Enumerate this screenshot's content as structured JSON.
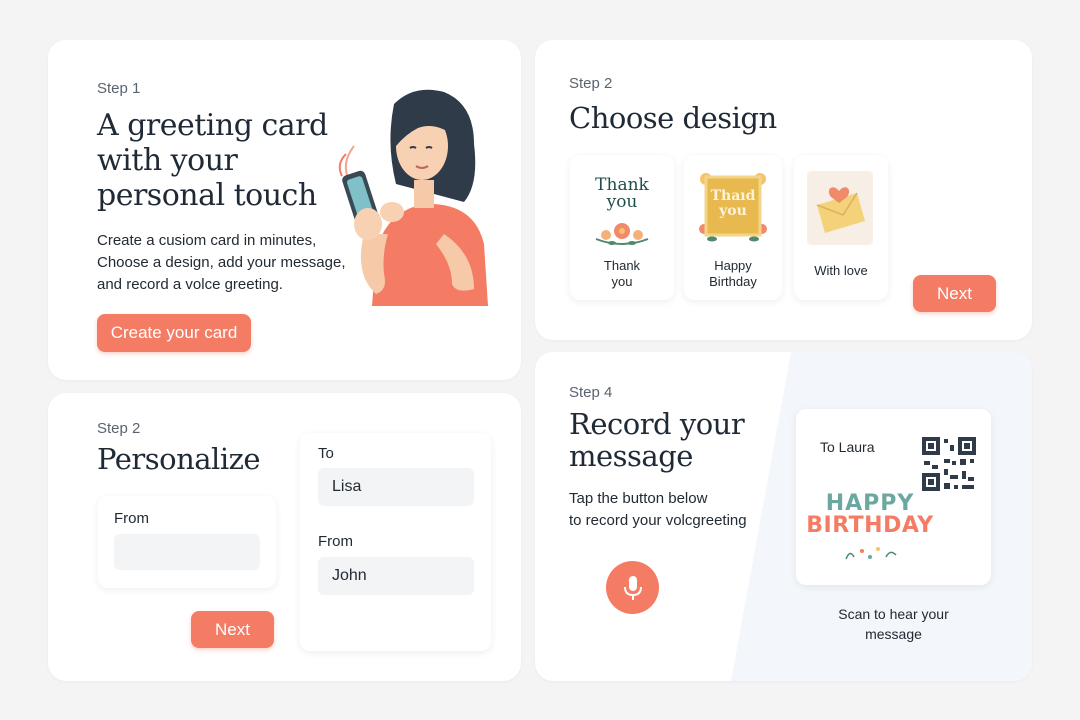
{
  "step1": {
    "step": "Step 1",
    "title_lines": [
      "A greeting card",
      "with your",
      "personal touch"
    ],
    "desc_lines": [
      "Create a cusiom card in minutes,",
      "Choose a design, add your message,",
      "and record a volce greeting."
    ],
    "cta": "Create your card"
  },
  "step2_design": {
    "step": "Step 2",
    "title": "Choose design",
    "designs": [
      {
        "art_text_1": "Thank",
        "art_text_2": "you",
        "label_1": "Thank",
        "label_2": "you"
      },
      {
        "art_text_1": "Thaıd",
        "art_text_2": "you",
        "label_1": "Happy",
        "label_2": "Birthday"
      },
      {
        "label_1": "With love"
      }
    ],
    "next": "Next"
  },
  "step2_personalize": {
    "step": "Step 2",
    "title": "Personalize",
    "from_label": "From",
    "from_value": "",
    "to_label": "To",
    "to_value": "Lisa",
    "from2_label": "From",
    "from2_value": "John",
    "next": "Next"
  },
  "step4": {
    "step": "Step 4",
    "title_lines": [
      "Record your",
      "message"
    ],
    "desc_lines": [
      "Tap the button below",
      "to record your volcgreeting"
    ],
    "preview_to": "To Laura",
    "preview_happy": "HAPPY",
    "preview_birthday": "BIRTHDAY",
    "scan_lines": [
      "Scan to hear your",
      "message"
    ]
  },
  "colors": {
    "accent": "#f47c64",
    "heading": "#1f2a36",
    "birthday_teal": "#6aa8a0"
  }
}
